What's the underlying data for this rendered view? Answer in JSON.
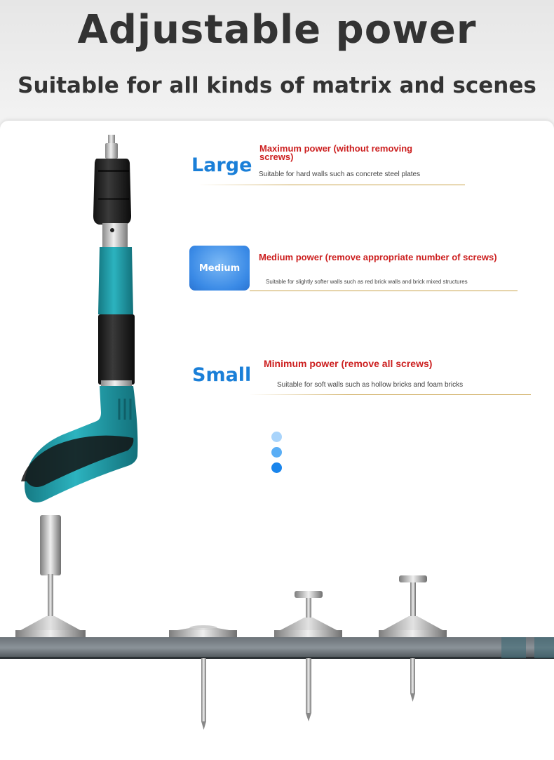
{
  "header": {
    "title": "Adjustable power",
    "subtitle": "Suitable for all kinds of matrix and scenes"
  },
  "levels": [
    {
      "label": "Large",
      "title": "Maximum power (without removing screws)",
      "description": "Suitable for hard walls such as concrete steel plates"
    },
    {
      "label": "Medium",
      "title": "Medium power (remove appropriate number of screws)",
      "description": "Suitable for slightly softer walls such as red brick walls and brick mixed structures"
    },
    {
      "label": "Small",
      "title": "Minimum power (remove all screws)",
      "description": "Suitable for soft walls such as hollow bricks and foam bricks"
    }
  ],
  "colors": {
    "label_blue": "#1a7fd8",
    "title_red": "#cc1f1f",
    "divider_gold": "#c9a24a",
    "tool_teal": "#1f9aa6",
    "dot_1": "#a9d4fb",
    "dot_2": "#5aaef5",
    "dot_3": "#1a85ec"
  },
  "icons": {
    "tool": "nail-gun-illustration",
    "board": "concrete-board-with-nails-illustration"
  }
}
